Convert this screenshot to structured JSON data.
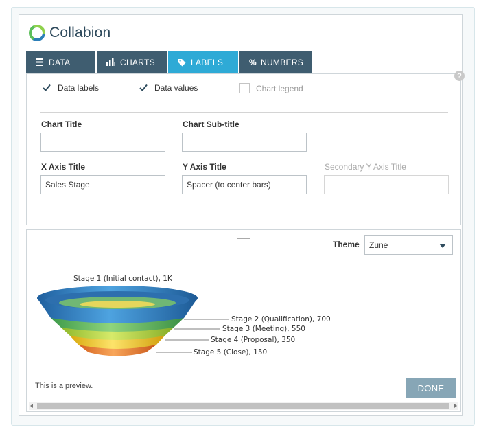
{
  "app": {
    "name": "Collabion"
  },
  "tabs": [
    {
      "label": "DATA",
      "icon": "menu-icon"
    },
    {
      "label": "CHARTS",
      "icon": "bar-chart-icon"
    },
    {
      "label": "LABELS",
      "icon": "tag-icon",
      "active": true
    },
    {
      "label": "NUMBERS",
      "icon": "percent-icon"
    }
  ],
  "colors": {
    "tab": "#3f5d70",
    "tab_active": "#2eaad6",
    "done_button": "#87a6b6"
  },
  "options": {
    "data_labels": {
      "label": "Data labels",
      "checked": true
    },
    "data_values": {
      "label": "Data values",
      "checked": true
    },
    "chart_legend": {
      "label": "Chart legend",
      "checked": false,
      "disabled": true
    }
  },
  "fields": {
    "chart_title": {
      "label": "Chart Title",
      "value": ""
    },
    "chart_subtitle": {
      "label": "Chart Sub-title",
      "value": ""
    },
    "x_axis_title": {
      "label": "X Axis Title",
      "value": "Sales Stage"
    },
    "y_axis_title": {
      "label": "Y Axis Title",
      "value": "Spacer (to center bars)"
    },
    "secondary_y_axis_title": {
      "label": "Secondary Y Axis Title",
      "value": "",
      "disabled": true
    }
  },
  "theme": {
    "label": "Theme",
    "value": "Zune"
  },
  "preview_note": "This is a preview.",
  "done_label": "DONE",
  "help_glyph": "?",
  "funnel_labels": [
    "Stage 1 (Initial contact), 1K",
    "Stage 2 (Qualification), 700",
    "Stage 3 (Meeting), 550",
    "Stage 4 (Proposal), 350",
    "Stage 5 (Close), 150"
  ]
}
